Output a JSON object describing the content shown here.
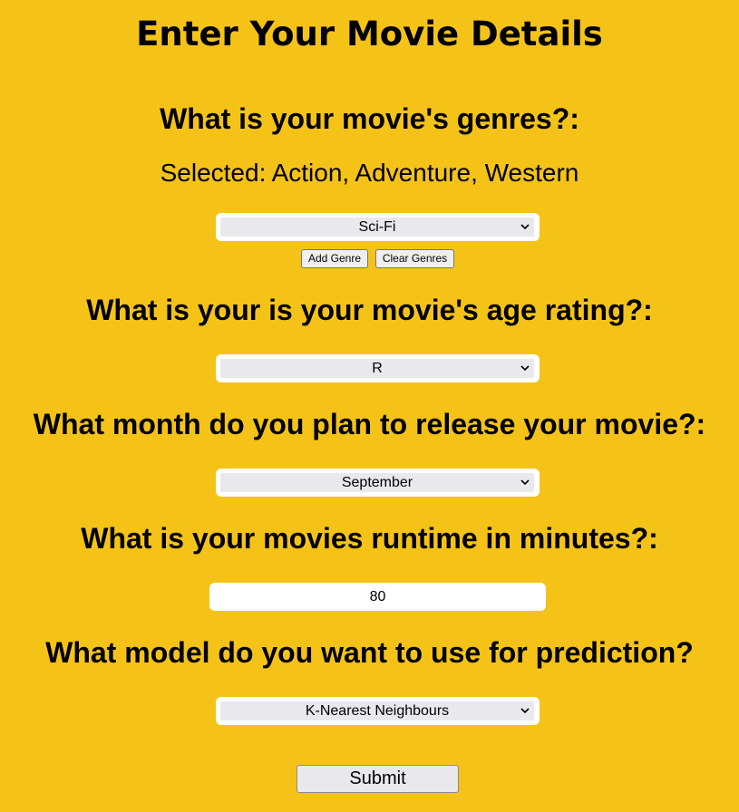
{
  "page": {
    "title": "Enter Your Movie Details"
  },
  "genres": {
    "question": "What is your movie's genres?:",
    "selected_text": "Selected: Action, Adventure, Western",
    "select_value": "Sci-Fi",
    "add_button": "Add Genre",
    "clear_button": "Clear Genres"
  },
  "age_rating": {
    "question": "What is your is your movie's age rating?:",
    "select_value": "R"
  },
  "release_month": {
    "question": "What month do you plan to release your movie?:",
    "select_value": "September"
  },
  "runtime": {
    "question": "What is your movies runtime in minutes?:",
    "value": "80"
  },
  "model": {
    "question": "What model do you want to use for prediction?",
    "select_value": "K-Nearest Neighbours"
  },
  "submit": {
    "label": "Submit"
  },
  "icons": {
    "dropdown": "chevron-down-icon"
  }
}
